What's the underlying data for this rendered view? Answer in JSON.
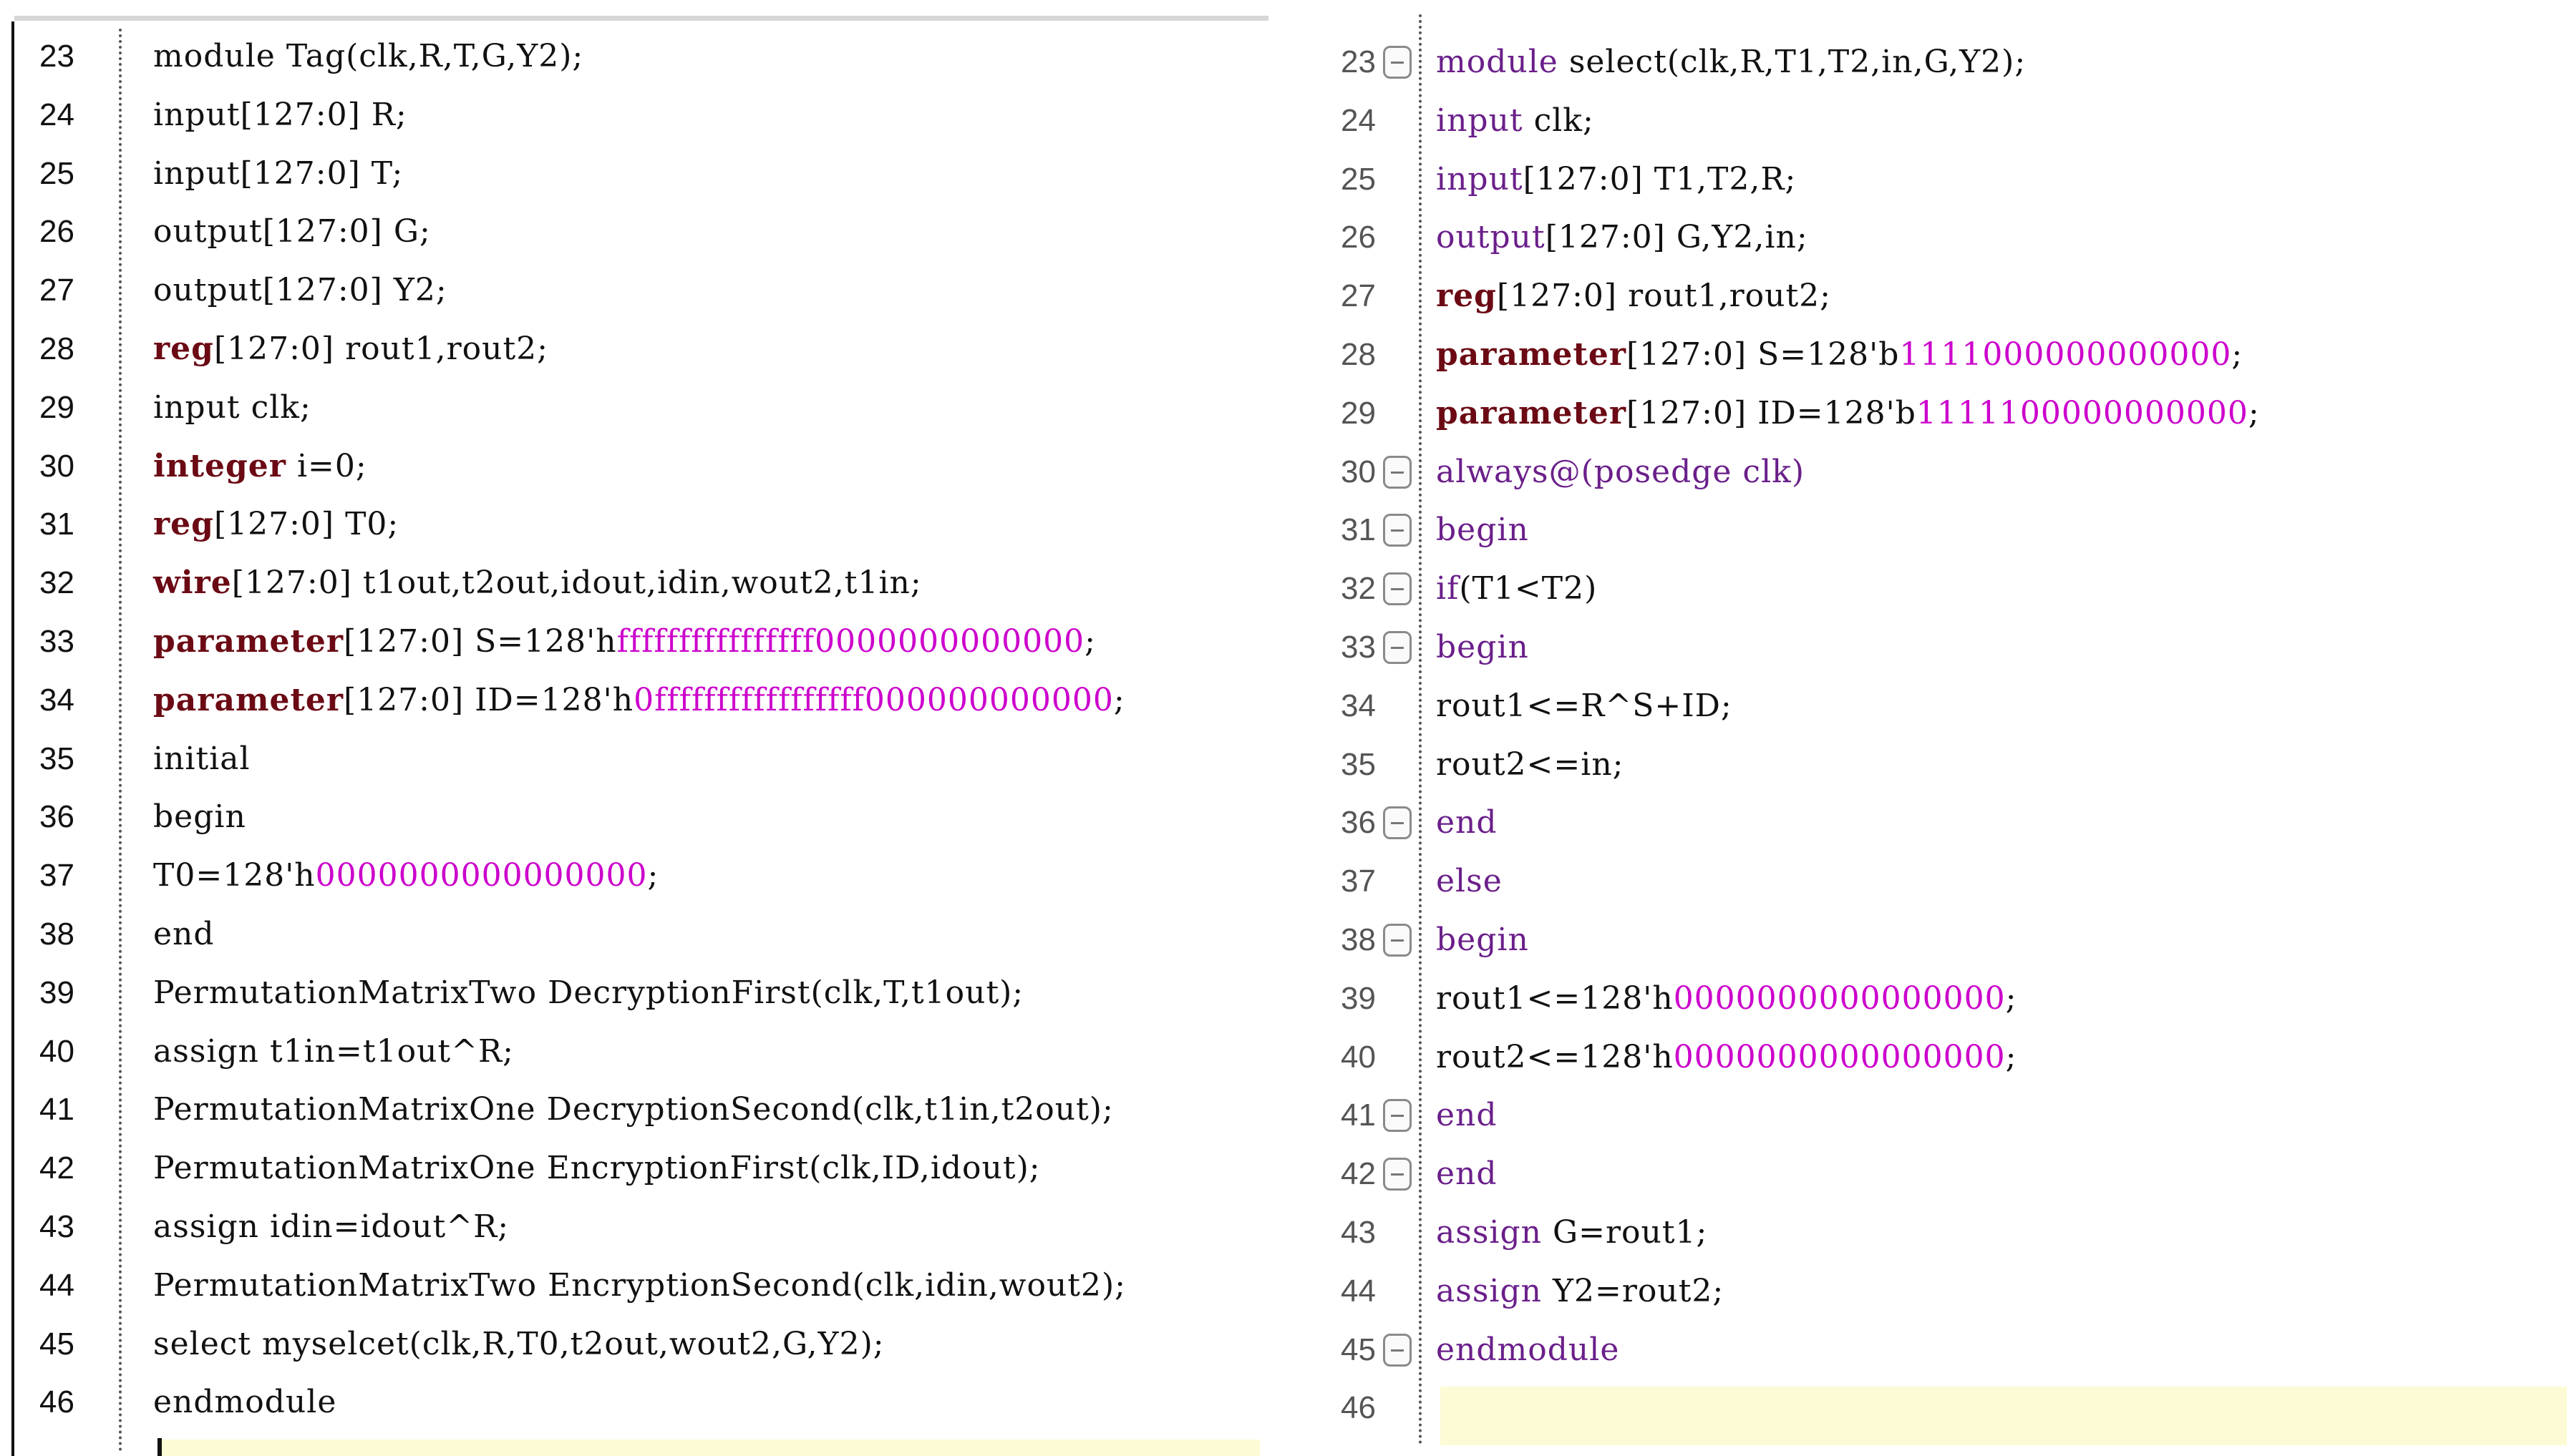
{
  "left_editor": {
    "lines": [
      {
        "n": "23",
        "segs": [
          {
            "t": "module Tag(clk,R,T,G,Y2);"
          }
        ]
      },
      {
        "n": "24",
        "segs": [
          {
            "t": "input[127:0] R;"
          }
        ]
      },
      {
        "n": "25",
        "segs": [
          {
            "t": "input[127:0] T;"
          }
        ]
      },
      {
        "n": "26",
        "segs": [
          {
            "t": "output[127:0] G;"
          }
        ]
      },
      {
        "n": "27",
        "segs": [
          {
            "t": "output[127:0] Y2;"
          }
        ]
      },
      {
        "n": "28",
        "segs": [
          {
            "t": "reg",
            "c": "kw-bold"
          },
          {
            "t": "[127:0] rout1,rout2;"
          }
        ]
      },
      {
        "n": "29",
        "segs": [
          {
            "t": "input clk;"
          }
        ]
      },
      {
        "n": "30",
        "segs": [
          {
            "t": "integer",
            "c": "kw-bold"
          },
          {
            "t": " i=0;"
          }
        ]
      },
      {
        "n": "31",
        "segs": [
          {
            "t": "reg",
            "c": "kw-bold"
          },
          {
            "t": "[127:0] T0;"
          }
        ]
      },
      {
        "n": "32",
        "segs": [
          {
            "t": "wire",
            "c": "kw-bold"
          },
          {
            "t": "[127:0] t1out,t2out,idout,idin,wout2,t1in;"
          }
        ]
      },
      {
        "n": "33",
        "segs": [
          {
            "t": "parameter",
            "c": "kw-bold"
          },
          {
            "t": "[127:0] S=128'h"
          },
          {
            "t": "ffffffffffffffff0000000000000",
            "c": "num"
          },
          {
            "t": ";"
          }
        ]
      },
      {
        "n": "34",
        "segs": [
          {
            "t": "parameter",
            "c": "kw-bold"
          },
          {
            "t": "[127:0] ID=128'h"
          },
          {
            "t": "0fffffffffffffffff000000000000",
            "c": "num"
          },
          {
            "t": ";"
          }
        ]
      },
      {
        "n": "35",
        "segs": [
          {
            "t": "initial"
          }
        ]
      },
      {
        "n": "36",
        "segs": [
          {
            "t": "begin"
          }
        ]
      },
      {
        "n": "37",
        "segs": [
          {
            "t": "T0=128'h"
          },
          {
            "t": "0000000000000000",
            "c": "num"
          },
          {
            "t": ";"
          }
        ]
      },
      {
        "n": "38",
        "segs": [
          {
            "t": "end"
          }
        ]
      },
      {
        "n": "39",
        "segs": [
          {
            "t": "PermutationMatrixTwo DecryptionFirst(clk,T,t1out);"
          }
        ]
      },
      {
        "n": "40",
        "segs": [
          {
            "t": "assign t1in=t1out^R;"
          }
        ]
      },
      {
        "n": "41",
        "segs": [
          {
            "t": "PermutationMatrixOne DecryptionSecond(clk,t1in,t2out);"
          }
        ]
      },
      {
        "n": "42",
        "segs": [
          {
            "t": "PermutationMatrixOne EncryptionFirst(clk,ID,idout);"
          }
        ]
      },
      {
        "n": "43",
        "segs": [
          {
            "t": "assign idin=idout^R;"
          }
        ]
      },
      {
        "n": "44",
        "segs": [
          {
            "t": "PermutationMatrixTwo EncryptionSecond(clk,idin,wout2);"
          }
        ]
      },
      {
        "n": "45",
        "segs": [
          {
            "t": "select myselcet(clk,R,T0,t2out,wout2,G,Y2);"
          }
        ]
      },
      {
        "n": "46",
        "segs": [
          {
            "t": "endmodule"
          }
        ]
      }
    ]
  },
  "right_editor": {
    "lines": [
      {
        "n": "23",
        "fold": true,
        "segs": [
          {
            "t": "module",
            "c": "kw-blue"
          },
          {
            "t": " select(clk,R,T1,T2,in,G,Y2);"
          }
        ]
      },
      {
        "n": "24",
        "segs": [
          {
            "t": "input",
            "c": "kw-blue"
          },
          {
            "t": " clk;"
          }
        ]
      },
      {
        "n": "25",
        "segs": [
          {
            "t": "input",
            "c": "kw-blue"
          },
          {
            "t": "[127:0] T1,T2,R;"
          }
        ]
      },
      {
        "n": "26",
        "segs": [
          {
            "t": "output",
            "c": "kw-blue"
          },
          {
            "t": "[127:0] G,Y2,in;"
          }
        ]
      },
      {
        "n": "27",
        "segs": [
          {
            "t": "reg",
            "c": "kw-bold"
          },
          {
            "t": "[127:0] rout1,rout2;"
          }
        ]
      },
      {
        "n": "28",
        "segs": [
          {
            "t": "parameter",
            "c": "kw-bold"
          },
          {
            "t": "[127:0] S=128'b"
          },
          {
            "t": "1111000000000000",
            "c": "num"
          },
          {
            "t": ";"
          }
        ]
      },
      {
        "n": "29",
        "segs": [
          {
            "t": "parameter",
            "c": "kw-bold"
          },
          {
            "t": "[127:0] ID=128'b"
          },
          {
            "t": "1111100000000000",
            "c": "num"
          },
          {
            "t": ";"
          }
        ]
      },
      {
        "n": "30",
        "fold": true,
        "segs": [
          {
            "t": "always@(posedge clk)",
            "c": "kw-blue"
          }
        ]
      },
      {
        "n": "31",
        "fold": true,
        "segs": [
          {
            "t": "begin",
            "c": "kw-blue"
          }
        ]
      },
      {
        "n": "32",
        "fold": true,
        "segs": [
          {
            "t": "if",
            "c": "kw-blue"
          },
          {
            "t": "(T1<T2)"
          }
        ]
      },
      {
        "n": "33",
        "fold": true,
        "segs": [
          {
            "t": "begin",
            "c": "kw-blue"
          }
        ]
      },
      {
        "n": "34",
        "segs": [
          {
            "t": "rout1<=R^S+ID;"
          }
        ]
      },
      {
        "n": "35",
        "segs": [
          {
            "t": "rout2<=in;"
          }
        ]
      },
      {
        "n": "36",
        "fold": true,
        "segs": [
          {
            "t": "end",
            "c": "kw-blue"
          }
        ]
      },
      {
        "n": "37",
        "segs": [
          {
            "t": "else",
            "c": "kw-blue"
          }
        ]
      },
      {
        "n": "38",
        "fold": true,
        "segs": [
          {
            "t": "begin",
            "c": "kw-blue"
          }
        ]
      },
      {
        "n": "39",
        "segs": [
          {
            "t": "rout1<=128'h"
          },
          {
            "t": "0000000000000000",
            "c": "num"
          },
          {
            "t": ";"
          }
        ]
      },
      {
        "n": "40",
        "segs": [
          {
            "t": "rout2<=128'h"
          },
          {
            "t": "0000000000000000",
            "c": "num"
          },
          {
            "t": ";"
          }
        ]
      },
      {
        "n": "41",
        "fold": true,
        "segs": [
          {
            "t": "end",
            "c": "kw-blue"
          }
        ]
      },
      {
        "n": "42",
        "fold": true,
        "segs": [
          {
            "t": "end",
            "c": "kw-blue"
          }
        ]
      },
      {
        "n": "43",
        "segs": [
          {
            "t": "assign",
            "c": "kw-blue"
          },
          {
            "t": " G=rout1;"
          }
        ]
      },
      {
        "n": "44",
        "segs": [
          {
            "t": "assign",
            "c": "kw-blue"
          },
          {
            "t": " Y2=rout2;"
          }
        ]
      },
      {
        "n": "45",
        "fold": true,
        "segs": [
          {
            "t": "endmodule",
            "c": "kw-blue"
          }
        ]
      },
      {
        "n": "46",
        "segs": []
      }
    ]
  }
}
